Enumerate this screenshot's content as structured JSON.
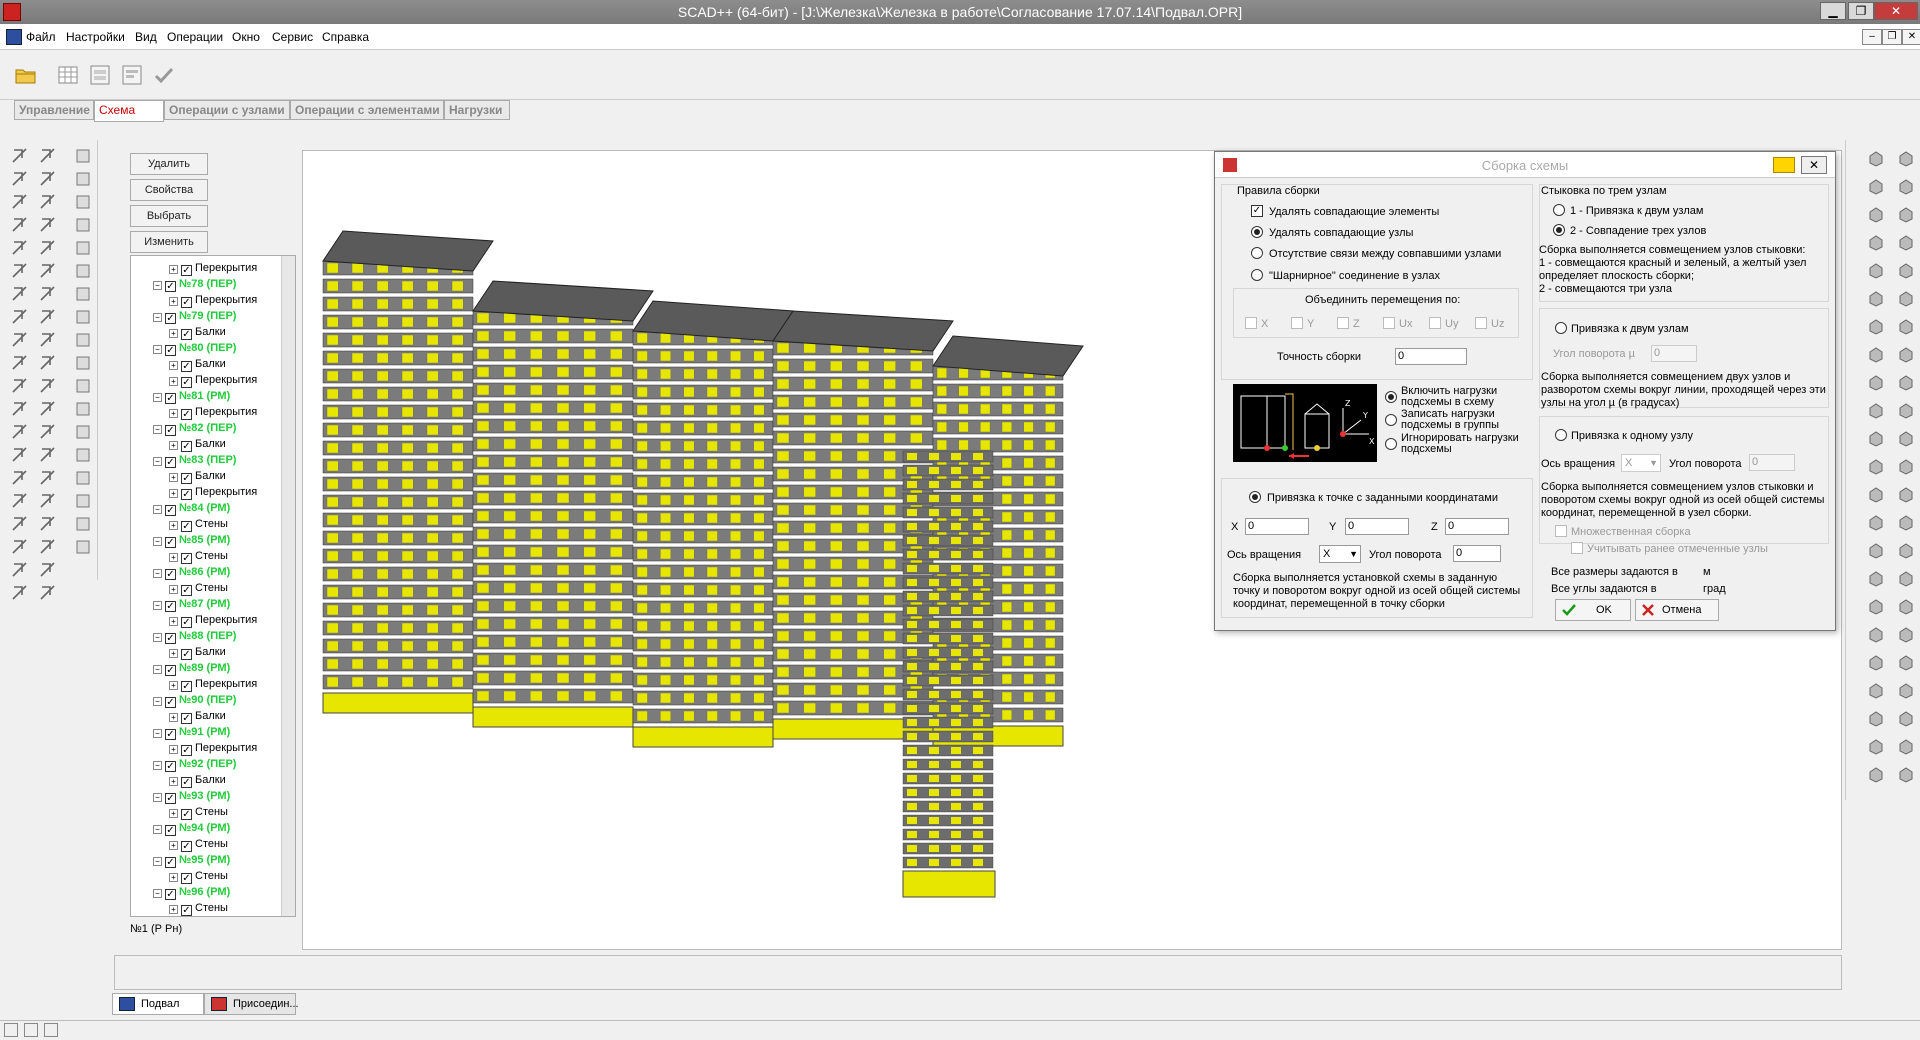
{
  "window": {
    "title": "SCAD++ (64-бит) - [J:\\Железка\\Железка в работе\\Согласование 17.07.14\\Подвал.OPR]",
    "min_label": "▁",
    "max_label": "❐",
    "close_label": "✕"
  },
  "menu": [
    "Файл",
    "Настройки",
    "Вид",
    "Операции",
    "Окно",
    "Сервис",
    "Справка"
  ],
  "mdi": {
    "min": "–",
    "restore": "❐",
    "close": "✕"
  },
  "tabs": [
    {
      "label": "Управление",
      "active": false
    },
    {
      "label": "Схема",
      "active": true
    },
    {
      "label": "Операции с узлами",
      "active": false
    },
    {
      "label": "Операции с элементами",
      "active": false
    },
    {
      "label": "Нагрузки",
      "active": false
    }
  ],
  "side_buttons": [
    "Удалить",
    "Свойства",
    "Выбрать",
    "Изменить"
  ],
  "tree": [
    {
      "type": "leaf",
      "label": "Перекрытия"
    },
    {
      "type": "node",
      "label": "№78 (ПЕР)"
    },
    {
      "type": "leaf",
      "label": "Перекрытия"
    },
    {
      "type": "node",
      "label": "№79 (ПЕР)"
    },
    {
      "type": "leaf",
      "label": "Балки"
    },
    {
      "type": "node",
      "label": "№80 (ПЕР)"
    },
    {
      "type": "leaf",
      "label": "Балки"
    },
    {
      "type": "leaf",
      "label": "Перекрытия"
    },
    {
      "type": "node",
      "label": "№81 (РМ)"
    },
    {
      "type": "leaf",
      "label": "Перекрытия"
    },
    {
      "type": "node",
      "label": "№82 (ПЕР)"
    },
    {
      "type": "leaf",
      "label": "Балки"
    },
    {
      "type": "node",
      "label": "№83 (ПЕР)"
    },
    {
      "type": "leaf",
      "label": "Балки"
    },
    {
      "type": "leaf",
      "label": "Перекрытия"
    },
    {
      "type": "node",
      "label": "№84 (РМ)"
    },
    {
      "type": "leaf",
      "label": "Стены"
    },
    {
      "type": "node",
      "label": "№85 (РМ)"
    },
    {
      "type": "leaf",
      "label": "Стены"
    },
    {
      "type": "node",
      "label": "№86 (РМ)"
    },
    {
      "type": "leaf",
      "label": "Стены"
    },
    {
      "type": "node",
      "label": "№87 (РМ)"
    },
    {
      "type": "leaf",
      "label": "Перекрытия"
    },
    {
      "type": "node",
      "label": "№88 (ПЕР)"
    },
    {
      "type": "leaf",
      "label": "Балки"
    },
    {
      "type": "node",
      "label": "№89 (РМ)"
    },
    {
      "type": "leaf",
      "label": "Перекрытия"
    },
    {
      "type": "node",
      "label": "№90 (ПЕР)"
    },
    {
      "type": "leaf",
      "label": "Балки"
    },
    {
      "type": "node",
      "label": "№91 (РМ)"
    },
    {
      "type": "leaf",
      "label": "Перекрытия"
    },
    {
      "type": "node",
      "label": "№92 (ПЕР)"
    },
    {
      "type": "leaf",
      "label": "Балки"
    },
    {
      "type": "node",
      "label": "№93 (РМ)"
    },
    {
      "type": "leaf",
      "label": "Стены"
    },
    {
      "type": "node",
      "label": "№94 (РМ)"
    },
    {
      "type": "leaf",
      "label": "Стены"
    },
    {
      "type": "node",
      "label": "№95 (РМ)"
    },
    {
      "type": "leaf",
      "label": "Стены"
    },
    {
      "type": "node",
      "label": "№96 (РМ)"
    },
    {
      "type": "leaf",
      "label": "Стены"
    }
  ],
  "tree_status": "№1 (Р Рн)",
  "dialog": {
    "title": "Сборка схемы",
    "close": "✕",
    "rules": {
      "title": "Правила сборки",
      "opt_delete_elements": "Удалять совпадающие элементы",
      "opt_delete_nodes": "Удалять совпадающие узлы",
      "opt_no_link": "Отсутствие связи между совпавшими узлами",
      "opt_hinge": "\"Шарнирное\" соединение в узлах",
      "combine_title": "Объединить перемещения по:",
      "combine": [
        "X",
        "Y",
        "Z",
        "Ux",
        "Uy",
        "Uz"
      ],
      "precision_label": "Точность сборки",
      "precision_value": "0"
    },
    "loads": {
      "include": "Включить нагрузки подсхемы в схему",
      "to_groups": "Записать нагрузки подсхемы в группы",
      "ignore": "Игнорировать нагрузки подсхемы"
    },
    "point": {
      "title": "Привязка к точке с заданными координатами",
      "x_label": "X",
      "x": "0",
      "y_label": "Y",
      "y": "0",
      "z_label": "Z",
      "z": "0",
      "axis_label": "Ось вращения",
      "axis": "X",
      "angle_label": "Угол поворота",
      "angle": "0",
      "desc": "Сборка выполняется установкой схемы в заданную точку и поворотом вокруг одной из осей общей системы координат, перемещенной в точку сборки"
    },
    "three": {
      "title": "Стыковка по трем узлам",
      "opt1": "1 - Привязка к двум узлам",
      "opt2": "2 - Совпадение трех узлов",
      "desc": "Сборка выполняется совмещением узлов стыковки:\n1 - совмещаются красный и зеленый, а желтый узел определяет плоскость сборки;\n2 - совмещаются три узла"
    },
    "two": {
      "title": "Привязка к двум узлам",
      "angle_label": "Угол поворота µ",
      "angle": "0",
      "desc": "Сборка выполняется совмещением двух узлов и разворотом схемы вокруг линии, проходящей через эти узлы  на угол µ (в градусах)"
    },
    "one": {
      "title": "Привязка к одному узлу",
      "axis_label": "Ось вращения",
      "axis": "X",
      "angle_label": "Угол поворота",
      "angle": "0",
      "desc": "Сборка выполняется совмещением узлов стыковки и поворотом схемы вокруг одной из осей общей системы координат, перемещенной в узел сборки.",
      "multiple": "Множественная сборка",
      "consider": "Учитывать ранее отмеченные узлы"
    },
    "units": {
      "sizes": "Все размеры задаются в",
      "sizes_unit": "м",
      "angles": "Все углы задаются в",
      "angles_unit": "град"
    },
    "ok": "OK",
    "cancel": "Отмена"
  },
  "doc_tabs": [
    {
      "label": "Подвал",
      "active": true
    },
    {
      "label": "Присоедин...",
      "active": false
    }
  ],
  "colors": {
    "accent_tab": "#cc0000",
    "tree_node": "#1fcc3a",
    "slab": "#5a5a5a",
    "wall": "#e6e600"
  }
}
